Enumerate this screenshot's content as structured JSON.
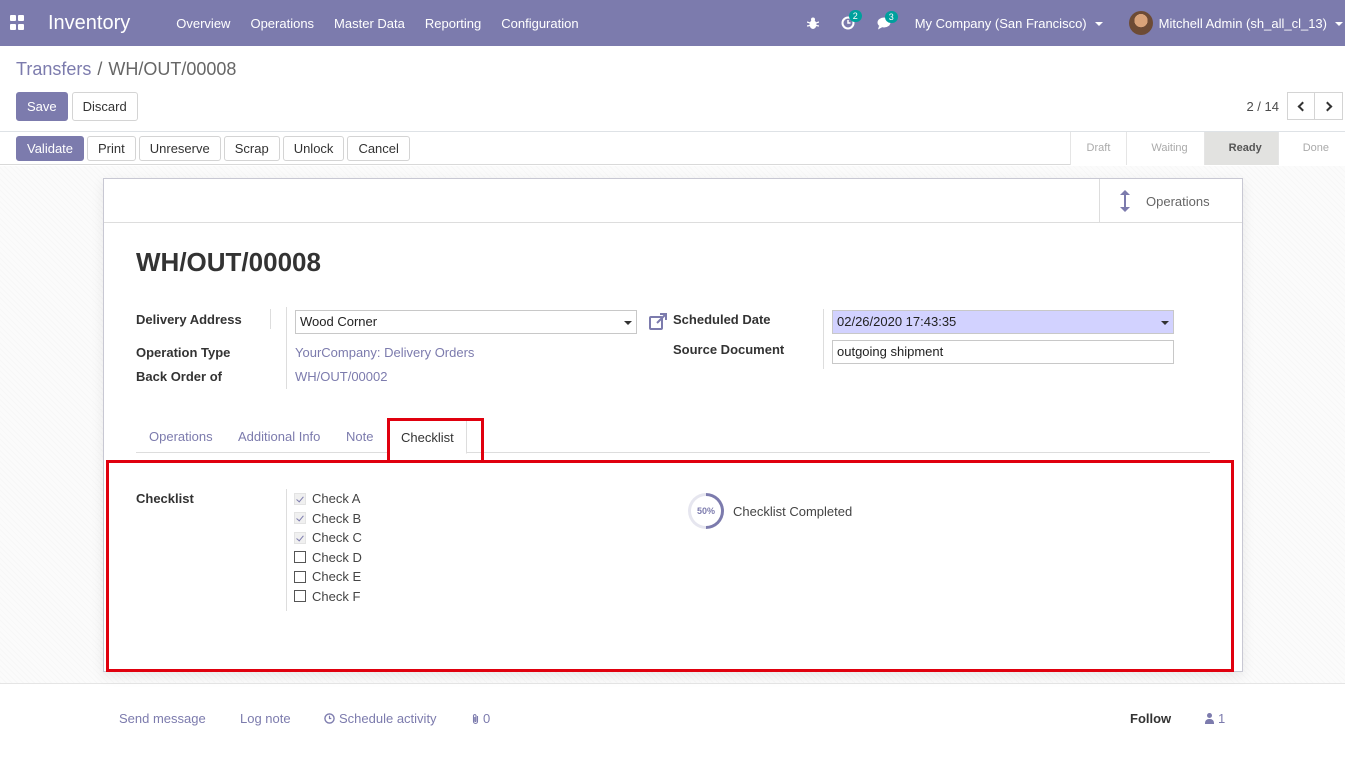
{
  "app": {
    "title": "Inventory"
  },
  "menu": [
    "Overview",
    "Operations",
    "Master Data",
    "Reporting",
    "Configuration"
  ],
  "systray": {
    "activity_count": "2",
    "message_count": "3",
    "company": "My Company (San Francisco)",
    "user": "Mitchell Admin (sh_all_cl_13)"
  },
  "breadcrumb": {
    "parent": "Transfers",
    "current": "WH/OUT/00008"
  },
  "control": {
    "save": "Save",
    "discard": "Discard",
    "pager_value": "2 / 14"
  },
  "header": {
    "buttons": [
      "Validate",
      "Print",
      "Unreserve",
      "Scrap",
      "Unlock",
      "Cancel"
    ],
    "statuses": [
      "Draft",
      "Waiting",
      "Ready",
      "Done"
    ],
    "active_status": "Ready"
  },
  "smart_button": {
    "label": "Operations"
  },
  "record": {
    "name": "WH/OUT/00008",
    "delivery_address_label": "Delivery Address",
    "delivery_address": "Wood Corner",
    "operation_type_label": "Operation Type",
    "operation_type": "YourCompany: Delivery Orders",
    "back_order_label": "Back Order of",
    "back_order": "WH/OUT/00002",
    "scheduled_date_label": "Scheduled Date",
    "scheduled_date": "02/26/2020 17:43:35",
    "source_document_label": "Source Document",
    "source_document": "outgoing shipment"
  },
  "tabs": [
    "Operations",
    "Additional Info",
    "Note",
    "Checklist"
  ],
  "active_tab": "Checklist",
  "checklist": {
    "label": "Checklist",
    "items": [
      {
        "label": "Check A",
        "checked": true
      },
      {
        "label": "Check B",
        "checked": true
      },
      {
        "label": "Check C",
        "checked": true
      },
      {
        "label": "Check D",
        "checked": false
      },
      {
        "label": "Check E",
        "checked": false
      },
      {
        "label": "Check F",
        "checked": false
      }
    ],
    "progress": 50,
    "progress_text": "50%",
    "progress_label": "Checklist Completed"
  },
  "chatter": {
    "send_message": "Send message",
    "log_note": "Log note",
    "schedule_activity": "Schedule activity",
    "attachments": "0",
    "follow": "Follow",
    "followers": "1"
  },
  "colors": {
    "brand": "#7c7bad",
    "highlight": "#e0000e"
  }
}
